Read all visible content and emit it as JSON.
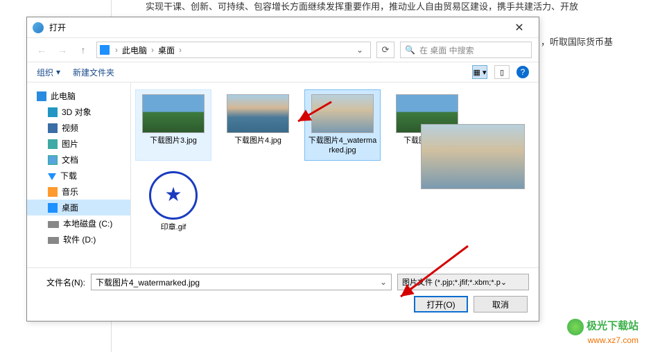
{
  "bg": {
    "line1": "实现干课、创新、可持续、包容增长方面继续发挥重要作用，推动业人自由贸易区建设，携手共建活力、开放",
    "line2": "，听取国际货币基"
  },
  "dialog": {
    "title": "打开",
    "close": "✕"
  },
  "nav": {
    "up": "↑",
    "breadcrumb": {
      "p1": "此电脑",
      "p2": "桌面"
    },
    "refresh": "⟳",
    "search_placeholder": "在 桌面 中搜索"
  },
  "toolbar": {
    "organize": "组织",
    "newfolder": "新建文件夹",
    "help": "?"
  },
  "sidebar": {
    "items": [
      {
        "label": "此电脑",
        "icon": "pc",
        "indent": false,
        "sel": false
      },
      {
        "label": "3D 对象",
        "icon": "cube",
        "indent": true,
        "sel": false
      },
      {
        "label": "视频",
        "icon": "video",
        "indent": true,
        "sel": false
      },
      {
        "label": "图片",
        "icon": "pic",
        "indent": true,
        "sel": false
      },
      {
        "label": "文档",
        "icon": "doc",
        "indent": true,
        "sel": false
      },
      {
        "label": "下载",
        "icon": "dl",
        "indent": true,
        "sel": false
      },
      {
        "label": "音乐",
        "icon": "music",
        "indent": true,
        "sel": false
      },
      {
        "label": "桌面",
        "icon": "desk",
        "indent": true,
        "sel": true
      },
      {
        "label": "本地磁盘 (C:)",
        "icon": "disk",
        "indent": true,
        "sel": false
      },
      {
        "label": "软件 (D:)",
        "icon": "disk",
        "indent": true,
        "sel": false
      }
    ]
  },
  "files": [
    {
      "name": "下载图片3.jpg",
      "thumb": "landscape",
      "sel": "hover"
    },
    {
      "name": "下载图片4.jpg",
      "thumb": "lake",
      "sel": ""
    },
    {
      "name": "下载图片4_watermarked.jpg",
      "thumb": "misty",
      "sel": "selected"
    },
    {
      "name": "下载图片5.jpg",
      "thumb": "landscape",
      "sel": ""
    },
    {
      "name": "印章.gif",
      "thumb": "stamp",
      "sel": ""
    }
  ],
  "bottom": {
    "filename_label": "文件名(N):",
    "filename_value": "下载图片4_watermarked.jpg",
    "filter": "图片文件 (*.pjp;*.jfif;*.xbm;*.p",
    "open": "打开(O)",
    "cancel": "取消"
  },
  "watermark": {
    "name": "极光下载站",
    "url": "www.xz7.com"
  }
}
